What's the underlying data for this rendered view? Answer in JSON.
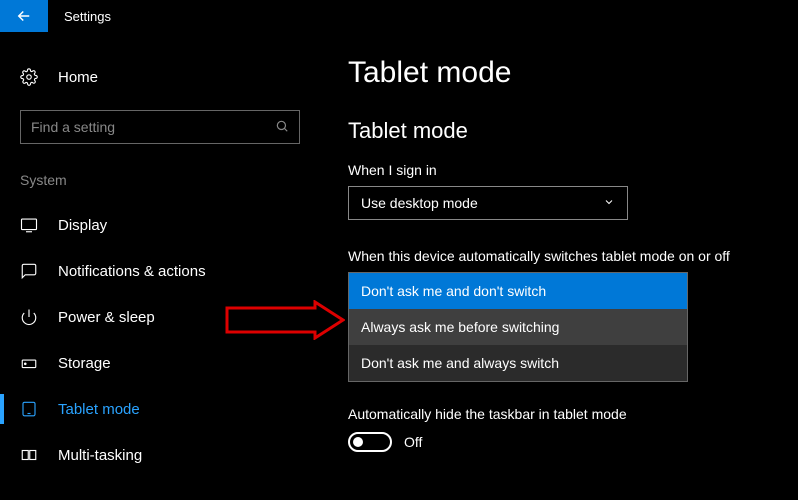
{
  "titlebar": {
    "label": "Settings"
  },
  "sidebar": {
    "home_label": "Home",
    "search_placeholder": "Find a setting",
    "group_label": "System",
    "items": [
      {
        "label": "Display"
      },
      {
        "label": "Notifications & actions"
      },
      {
        "label": "Power & sleep"
      },
      {
        "label": "Storage"
      },
      {
        "label": "Tablet mode"
      },
      {
        "label": "Multi-tasking"
      }
    ]
  },
  "main": {
    "page_title": "Tablet mode",
    "section_title": "Tablet mode",
    "signin_label": "When I sign in",
    "signin_value": "Use desktop mode",
    "switch_label": "When this device automatically switches tablet mode on or off",
    "dropdown_options": [
      "Don't ask me and don't switch",
      "Always ask me before switching",
      "Don't ask me and always switch"
    ],
    "autohide_label": "Automatically hide the taskbar in tablet mode",
    "autohide_value": "Off"
  }
}
